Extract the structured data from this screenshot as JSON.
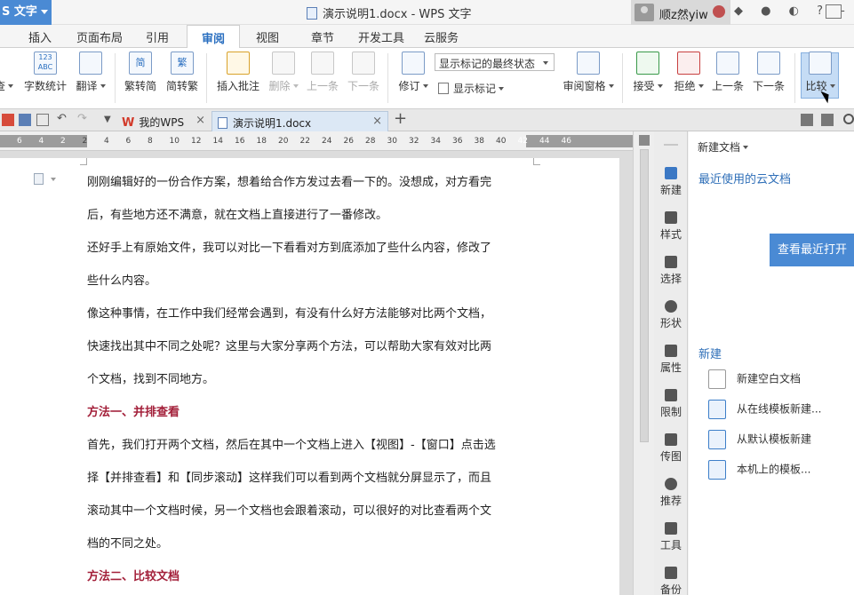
{
  "window": {
    "app_button": "S 文字",
    "title": "演示说明1.docx - WPS 文字",
    "user_name": "顺z然yiw",
    "top_icons": "◆ ● ◐ ? -"
  },
  "menu_tabs": [
    {
      "label": "插入"
    },
    {
      "label": "页面布局"
    },
    {
      "label": "引用"
    },
    {
      "label": "审阅"
    },
    {
      "label": "视图"
    },
    {
      "label": "章节"
    },
    {
      "label": "开发工具"
    },
    {
      "label": "云服务"
    }
  ],
  "ribbon": {
    "check_partial": "查",
    "word_count": "字数统计",
    "translate": "翻译",
    "trad_to_simp": "繁转简",
    "simp_to_trad": "简转繁",
    "insert_comment": "插入批注",
    "delete": "删除",
    "prev_comment": "上一条",
    "next_comment": "下一条",
    "revise": "修订",
    "markup_state": "显示标记的最终状态",
    "show_markup": "显示标记",
    "review_pane": "审阅窗格",
    "accept": "接受",
    "reject": "拒绝",
    "prev_change": "上一条",
    "next_change": "下一条",
    "compare": "比较",
    "icon_123": "123",
    "icon_abc": "ABC",
    "icon_simp": "简",
    "icon_trad": "繁"
  },
  "doc_tabs": {
    "home": "我的WPS",
    "home_logo": "W",
    "current": "演示说明1.docx",
    "close": "×",
    "new": "+"
  },
  "ruler": {
    "labels": [
      "6",
      "4",
      "2",
      "2",
      "4",
      "6",
      "8",
      "10",
      "12",
      "14",
      "16",
      "18",
      "20",
      "22",
      "24",
      "26",
      "28",
      "30",
      "32",
      "34",
      "36",
      "38",
      "40",
      "42",
      "44",
      "46"
    ]
  },
  "document": {
    "lines": [
      "刚刚编辑好的一份合作方案，想着给合作方发过去看一下的。没想成，对方看完",
      "后，有些地方还不满意，就在文档上直接进行了一番修改。",
      "还好手上有原始文件，我可以对比一下看看对方到底添加了些什么内容，修改了",
      "些什么内容。",
      "像这种事情，在工作中我们经常会遇到，有没有什么好方法能够对比两个文档，",
      "快速找出其中不同之处呢？这里与大家分享两个方法，可以帮助大家有效对比两",
      "个文档，找到不同地方。"
    ],
    "heading1": "方法一、并排查看",
    "lines2": [
      "首先，我们打开两个文档，然后在其中一个文档上进入【视图】-【窗口】点击选",
      "择【并排查看】和【同步滚动】这样我们可以看到两个文档就分屏显示了，而且",
      "滚动其中一个文档时候，另一个文档也会跟着滚动，可以很好的对比查看两个文",
      "档的不同之处。"
    ],
    "heading2": "方法二、比较文档"
  },
  "sidebar": [
    {
      "label": "新建",
      "icon": "new-doc-icon"
    },
    {
      "label": "样式",
      "icon": "style-icon"
    },
    {
      "label": "选择",
      "icon": "select-icon"
    },
    {
      "label": "形状",
      "icon": "shape-icon"
    },
    {
      "label": "属性",
      "icon": "properties-icon"
    },
    {
      "label": "限制",
      "icon": "restrict-icon"
    },
    {
      "label": "传图",
      "icon": "upload-image-icon"
    },
    {
      "label": "推荐",
      "icon": "recommend-icon"
    },
    {
      "label": "工具",
      "icon": "tools-icon"
    },
    {
      "label": "备份",
      "icon": "backup-icon"
    }
  ],
  "taskpane": {
    "title": "新建文档",
    "recent_cloud": "最近使用的云文档",
    "view_recent_button": "查看最近打开",
    "new_section": "新建",
    "items": [
      {
        "label": "新建空白文档"
      },
      {
        "label": "从在线模板新建..."
      },
      {
        "label": "从默认模板新建"
      },
      {
        "label": "本机上的模板..."
      }
    ]
  },
  "colors": {
    "accent": "#4a8ad4",
    "heading": "#a3203a",
    "link": "#2f6fb8"
  }
}
